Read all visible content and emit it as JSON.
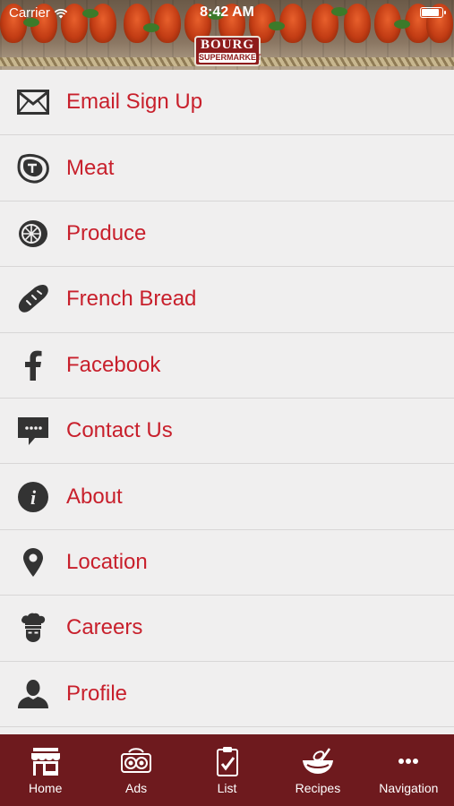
{
  "status_bar": {
    "carrier": "Carrier",
    "time": "8:42 AM"
  },
  "logo": {
    "line1": "BOURG",
    "line2": "SUPERMARKET"
  },
  "menu": {
    "items": [
      {
        "label": "Email Sign Up",
        "icon": "envelope-icon"
      },
      {
        "label": "Meat",
        "icon": "steak-icon"
      },
      {
        "label": "Produce",
        "icon": "lime-icon"
      },
      {
        "label": "French Bread",
        "icon": "bread-icon"
      },
      {
        "label": "Facebook",
        "icon": "facebook-icon"
      },
      {
        "label": "Contact Us",
        "icon": "chat-bubble-icon"
      },
      {
        "label": "About",
        "icon": "info-icon"
      },
      {
        "label": "Location",
        "icon": "map-pin-icon"
      },
      {
        "label": "Careers",
        "icon": "chef-icon"
      },
      {
        "label": "Profile",
        "icon": "person-icon"
      }
    ]
  },
  "tabbar": {
    "tabs": [
      {
        "label": "Home",
        "icon": "storefront-icon"
      },
      {
        "label": "Ads",
        "icon": "ads-icon"
      },
      {
        "label": "List",
        "icon": "clipboard-check-icon"
      },
      {
        "label": "Recipes",
        "icon": "mixing-bowl-icon"
      },
      {
        "label": "Navigation",
        "icon": "more-dots-icon"
      }
    ]
  },
  "colors": {
    "accent_text": "#c8202c",
    "tabbar_bg": "#6e1a1e",
    "list_bg": "#f0efef"
  }
}
